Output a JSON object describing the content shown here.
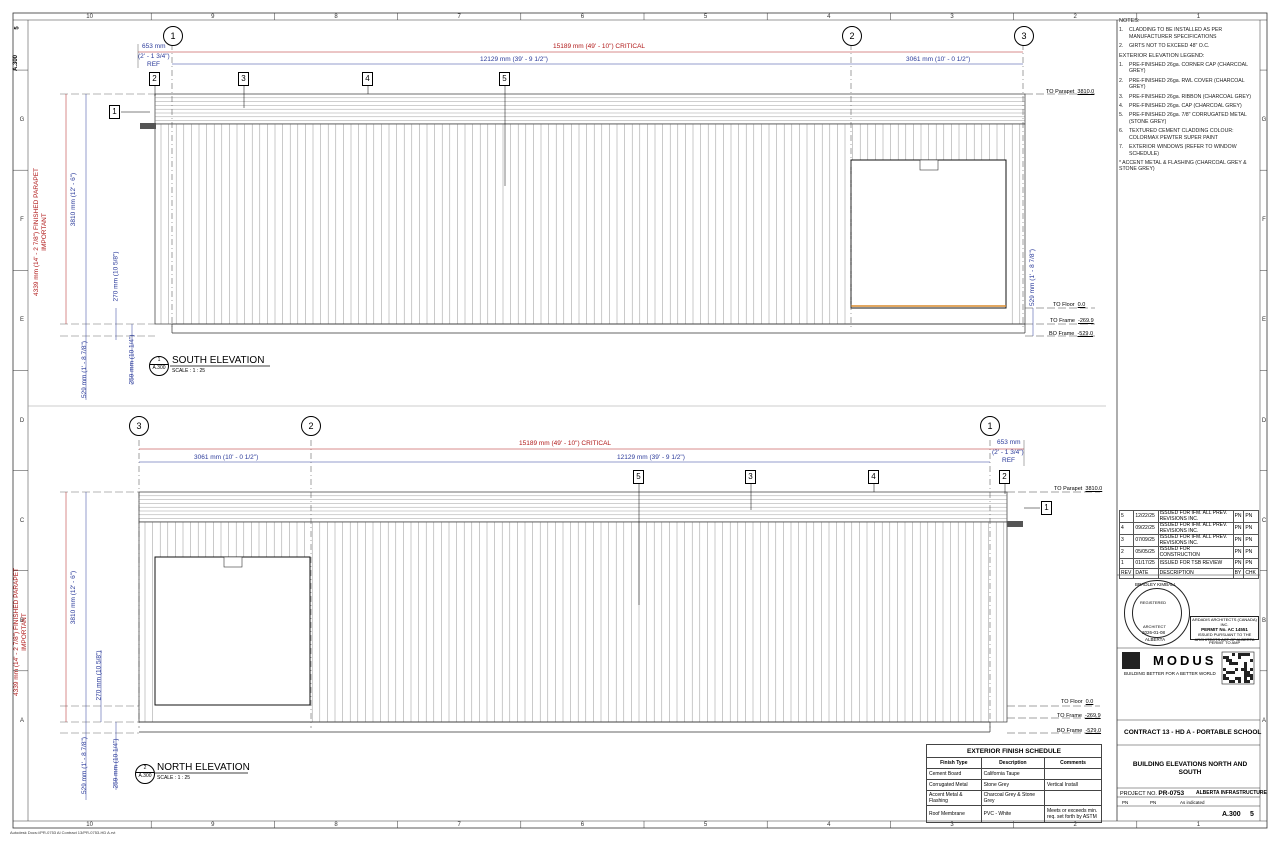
{
  "sheet": {
    "sheet_code": "A.300",
    "sheet_rev": "5",
    "grid_columns": [
      "10",
      "9",
      "8",
      "7",
      "6",
      "5",
      "4",
      "3",
      "2",
      "1"
    ],
    "grid_rows": [
      "G",
      "F",
      "E",
      "D",
      "C",
      "B",
      "A"
    ]
  },
  "south": {
    "title": "SOUTH ELEVATION",
    "scale": "SCALE : 1 : 25",
    "view_no": "1",
    "view_sheet": "A.300",
    "dim_overall": "15189 mm (49' - 10\") CRITICAL",
    "dim_ref_mm": "653 mm",
    "dim_ref_imp": "(2' - 1 3/4\")",
    "dim_ref_tag": "REF",
    "dim_mid": "12129 mm (39' - 9 1/2\")",
    "dim_right": "3061 mm (10' - 0 1/2\")",
    "dim_parapet": "4339 mm (14' - 2 7/8\") FINISHED PARAPET",
    "dim_parapet_tag": "IMPORTANT",
    "dim_wall": "3810 mm (12' - 6\")",
    "dim_floor": "270 mm (10 5/8\")",
    "dim_base": "529 mm (1' - 8 7/8\")",
    "dim_footing": "259 mm (10 1/4\")",
    "dim_right_side": "529 mm (1' - 8 7/8\")",
    "grids": [
      "1",
      "2",
      "3"
    ],
    "tags": [
      "1",
      "2",
      "3",
      "4",
      "5"
    ],
    "levels": [
      {
        "name": "TO Parapet",
        "value": "3810.0"
      },
      {
        "name": "TO Floor",
        "value": "0.0"
      },
      {
        "name": "TO Frame",
        "value": "-269.9"
      },
      {
        "name": "BO Frame",
        "value": "-529.0"
      }
    ]
  },
  "north": {
    "title": "NORTH ELEVATION",
    "scale": "SCALE : 1 : 25",
    "view_no": "2",
    "view_sheet": "A.300",
    "dim_overall": "15189 mm (49' - 10\") CRITICAL",
    "dim_left": "3061 mm (10' - 0 1/2\")",
    "dim_mid": "12129 mm (39' - 9 1/2\")",
    "dim_ref_mm": "653 mm",
    "dim_ref_imp": "(2' - 1 3/4\")",
    "dim_ref_tag": "REF",
    "dim_parapet": "4339 mm (14' - 2 7/8\") FINISHED PARAPET",
    "dim_parapet_tag": "IMPORTANT",
    "dim_wall": "3810 mm (12' - 6\")",
    "dim_floor": "270 mm (10 5/8\")",
    "dim_base": "529 mm (1' - 8 7/8\")",
    "dim_footing": "259 mm (10 1/4\")",
    "grids": [
      "3",
      "2",
      "1"
    ],
    "tags": [
      "5",
      "3",
      "4",
      "2",
      "1"
    ],
    "levels": [
      {
        "name": "TO Parapet",
        "value": "3810.0"
      },
      {
        "name": "TO Floor",
        "value": "0.0"
      },
      {
        "name": "TO Frame",
        "value": "-269.9"
      },
      {
        "name": "BO Frame",
        "value": "-529.0"
      }
    ]
  },
  "notes": {
    "heading": "NOTES:",
    "general": [
      {
        "n": "1.",
        "text": "CLADDING TO BE INSTALLED AS PER MANUFACTURER SPECIFICATIONS"
      },
      {
        "n": "2.",
        "text": "GIRTS NOT TO EXCEED 48\" O.C."
      }
    ],
    "legend_heading": "EXTERIOR ELEVATION LEGEND:",
    "legend": [
      {
        "n": "1.",
        "text": "PRE-FINISHED 26ga. CORNER CAP (CHARCOAL GREY)"
      },
      {
        "n": "2.",
        "text": "PRE-FINISHED 26ga. RWL COVER (CHARCOAL GREY)"
      },
      {
        "n": "3.",
        "text": "PRE-FINISHED 26ga. RIBBON (CHARCOAL GREY)"
      },
      {
        "n": "4.",
        "text": "PRE-FINISHED 26ga. CAP (CHARCOAL GREY)"
      },
      {
        "n": "5.",
        "text": "PRE-FINISHED 26ga. 7/8\" CORRUGATED METAL (STONE GREY)"
      },
      {
        "n": "6.",
        "text": "TEXTURED CEMENT CLADDING COLOUR: COLORMAX PEWTER SUPER PAINT"
      },
      {
        "n": "7.",
        "text": "EXTERIOR WINDOWS (REFER TO WINDOW SCHEDULE)"
      }
    ],
    "footnote": "* ACCENT METAL & FLASHING (CHARCOAL GREY & STONE GREY)"
  },
  "revisions": {
    "rows": [
      {
        "rev": "5",
        "date": "12/22/25",
        "desc": "ISSUED FOR IFM. ALL PREV. REVISIONS INC.",
        "by": "PN",
        "chk": "PN"
      },
      {
        "rev": "4",
        "date": "09/22/25",
        "desc": "ISSUED FOR IFM. ALL PREV. REVISIONS INC.",
        "by": "PN",
        "chk": "PN"
      },
      {
        "rev": "3",
        "date": "07/09/25",
        "desc": "ISSUED FOR IFM. ALL PREV. REVISIONS INC.",
        "by": "PN",
        "chk": "PN"
      },
      {
        "rev": "2",
        "date": "05/05/25",
        "desc": "ISSUED FOR CONSTRUCTION",
        "by": "PN",
        "chk": "PN"
      },
      {
        "rev": "1",
        "date": "01/17/25",
        "desc": "ISSUED FOR TSB REVIEW",
        "by": "PN",
        "chk": "PN"
      }
    ],
    "headers": [
      "REV",
      "DATE",
      "DESCRIPTION",
      "BY",
      "CHK"
    ]
  },
  "seal": {
    "name_top": "BRADLEY KIMBALL",
    "registered": "REGISTERED",
    "architect": "ARCHITECT",
    "date": "2026-01-08",
    "province": "ALBERTA",
    "permit_firm": "ARDADIS ARCHITECTS (CANADA) INC.",
    "permit_no": "PERMIT No. AC 14551",
    "permit_text": "ISSUED PURSUANT TO THE ARCHITECTS ACT OF ALBERTA",
    "permit_label": "PERMIT TO AMP"
  },
  "modus": {
    "brand": "MODUS",
    "tagline": "BUILDING BETTER FOR A BETTER WORLD"
  },
  "title_block": {
    "project": "CONTRACT 13 - HD A - PORTABLE SCHOOL",
    "drawing_title": "BUILDING ELEVATIONS NORTH AND SOUTH",
    "project_no_label": "PROJECT NO.",
    "project_no": "PR-0753",
    "client": "ALBERTA INFRASTRUCTURE",
    "drawn": "PN",
    "checked": "PN",
    "scale": "As indicated",
    "sheet": "A.300",
    "rev": "5"
  },
  "finish_schedule": {
    "title": "EXTERIOR FINISH SCHEDULE",
    "headers": [
      "Finish Type",
      "Description",
      "Comments"
    ],
    "rows": [
      {
        "type": "Cement Board",
        "desc": "California Taupe",
        "comments": ""
      },
      {
        "type": "Corrugated Metal",
        "desc": "Stone Grey",
        "comments": "Vertical Install"
      },
      {
        "type": "Accent Metal & Flashing",
        "desc": "Charcoal Grey & Stone Grey",
        "comments": ""
      },
      {
        "type": "Roof Membrane",
        "desc": "PVC - White",
        "comments": "Meets or exceeds min. req. set forth by ASTM"
      }
    ]
  },
  "footer_path": "Autodesk Docs://PR-0753 Al Contract 13/PR-0753-HD A.rvt"
}
